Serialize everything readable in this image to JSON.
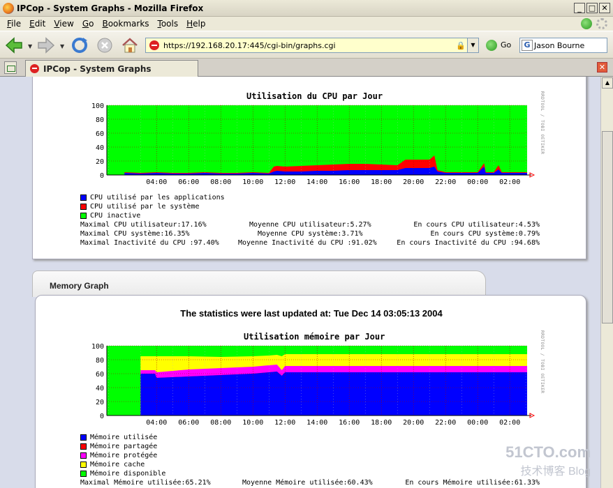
{
  "window": {
    "title": "IPCop - System Graphs - Mozilla Firefox"
  },
  "menu": [
    "File",
    "Edit",
    "View",
    "Go",
    "Bookmarks",
    "Tools",
    "Help"
  ],
  "menu_access": [
    "F",
    "E",
    "V",
    "G",
    "B",
    "T",
    "H"
  ],
  "nav": {
    "url": "https://192.168.20.17:445/cgi-bin/graphs.cgi",
    "go_label": "Go",
    "search_value": "Jason Bourne"
  },
  "tab": {
    "label": "IPCop - System Graphs"
  },
  "memory_section": {
    "header": "Memory Graph",
    "updated": "The statistics were last updated at: Tue Dec 14 03:05:13 2004"
  },
  "watermark": {
    "line1": "51CTO.com",
    "line2": "技术博客 Blog"
  },
  "chart_data": [
    {
      "type": "area",
      "title": "Utilisation du CPU par Jour",
      "side_label": "RRDTOOL / TOBI OETIKER",
      "ylim": [
        0,
        100
      ],
      "y_ticks": [
        0,
        20,
        40,
        60,
        80,
        100
      ],
      "x_ticks": [
        "04:00",
        "06:00",
        "08:00",
        "10:00",
        "12:00",
        "14:00",
        "16:00",
        "18:00",
        "20:00",
        "22:00",
        "00:00",
        "02:00"
      ],
      "x": [
        2.0,
        3.0,
        4.0,
        5.0,
        6.0,
        7.0,
        8.0,
        9.0,
        10.0,
        11.0,
        11.3,
        11.5,
        12.0,
        13.0,
        14.0,
        15.0,
        16.0,
        17.0,
        18.0,
        19.0,
        19.5,
        20.0,
        21.0,
        21.3,
        21.5,
        22.0,
        23.0,
        24.0,
        24.4,
        24.5,
        25.0,
        25.3,
        25.5,
        26.0,
        26.5,
        27.08
      ],
      "series": [
        {
          "name": "CPU utilisé par les applications",
          "color": "#0000ff",
          "values": [
            3,
            2,
            3,
            2,
            2,
            3,
            2,
            2,
            3,
            2,
            5,
            6,
            5,
            5,
            6,
            6,
            7,
            7,
            7,
            7,
            10,
            10,
            10,
            12,
            5,
            3,
            3,
            3,
            12,
            3,
            3,
            8,
            3,
            3,
            3,
            3
          ]
        },
        {
          "name": "CPU utilisé par le système",
          "color": "#ff0000",
          "values": [
            1,
            1,
            1,
            1,
            1,
            1,
            1,
            1,
            1,
            1,
            7,
            7,
            7,
            8,
            8,
            9,
            9,
            9,
            8,
            7,
            12,
            12,
            12,
            16,
            2,
            1,
            1,
            1,
            5,
            1,
            1,
            6,
            1,
            1,
            1,
            1
          ]
        },
        {
          "name": "CPU inactive",
          "color": "#00ff00",
          "values": []
        }
      ],
      "stats": [
        [
          "Maximal CPU utilisateur:17.16%",
          "Moyenne CPU utilisateur:5.27%",
          "En cours CPU utilisateur:4.53%"
        ],
        [
          "Maximal CPU système:16.35%",
          "Moyenne CPU système:3.71%",
          "En cours CPU système:0.79%"
        ],
        [
          "Maximal Inactivité du CPU :97.40%",
          "Moyenne Inactivité du CPU :91.02%",
          "En cours Inactivité du CPU :94.68%"
        ]
      ]
    },
    {
      "type": "area",
      "title": "Utilisation mémoire par Jour",
      "side_label": "RRDTOOL / TOBI OETIKER",
      "ylim": [
        0,
        100
      ],
      "y_ticks": [
        0,
        20,
        40,
        60,
        80,
        100
      ],
      "x_ticks": [
        "04:00",
        "06:00",
        "08:00",
        "10:00",
        "12:00",
        "14:00",
        "16:00",
        "18:00",
        "20:00",
        "22:00",
        "00:00",
        "02:00"
      ],
      "x": [
        3.0,
        3.9,
        4.0,
        6.0,
        8.0,
        10.0,
        11.0,
        11.5,
        11.8,
        12.0,
        14.0,
        16.0,
        18.0,
        20.0,
        22.0,
        24.0,
        27.08
      ],
      "series": [
        {
          "name": "Mémoire utilisée",
          "color": "#0000ff",
          "values": [
            60,
            60,
            54,
            56,
            58,
            60,
            62,
            63,
            57,
            62,
            62,
            62,
            62,
            62,
            62,
            62,
            62
          ]
        },
        {
          "name": "Mémoire partagée",
          "color": "#ff0000",
          "values": [
            0,
            0,
            0,
            0,
            0,
            0,
            0,
            0,
            0,
            0,
            0,
            0,
            0,
            0,
            0,
            0,
            0
          ]
        },
        {
          "name": "Mémoire protégée",
          "color": "#ff00ff",
          "values": [
            5,
            5,
            8,
            10,
            10,
            10,
            10,
            10,
            8,
            9,
            9,
            9,
            9,
            9,
            9,
            9,
            9
          ]
        },
        {
          "name": "Mémoire cache",
          "color": "#ffff00",
          "values": [
            20,
            20,
            23,
            19,
            16,
            15,
            14,
            14,
            20,
            17,
            17,
            17,
            17,
            17,
            17,
            17,
            17
          ]
        },
        {
          "name": "Mémoire disponible",
          "color": "#00ff00",
          "values": []
        }
      ],
      "stats": [
        [
          "Maximal Mémoire utilisée:65.21%",
          "Moyenne Mémoire utilisée:60.43%",
          "En cours Mémoire utilisée:61.33%"
        ]
      ]
    }
  ]
}
